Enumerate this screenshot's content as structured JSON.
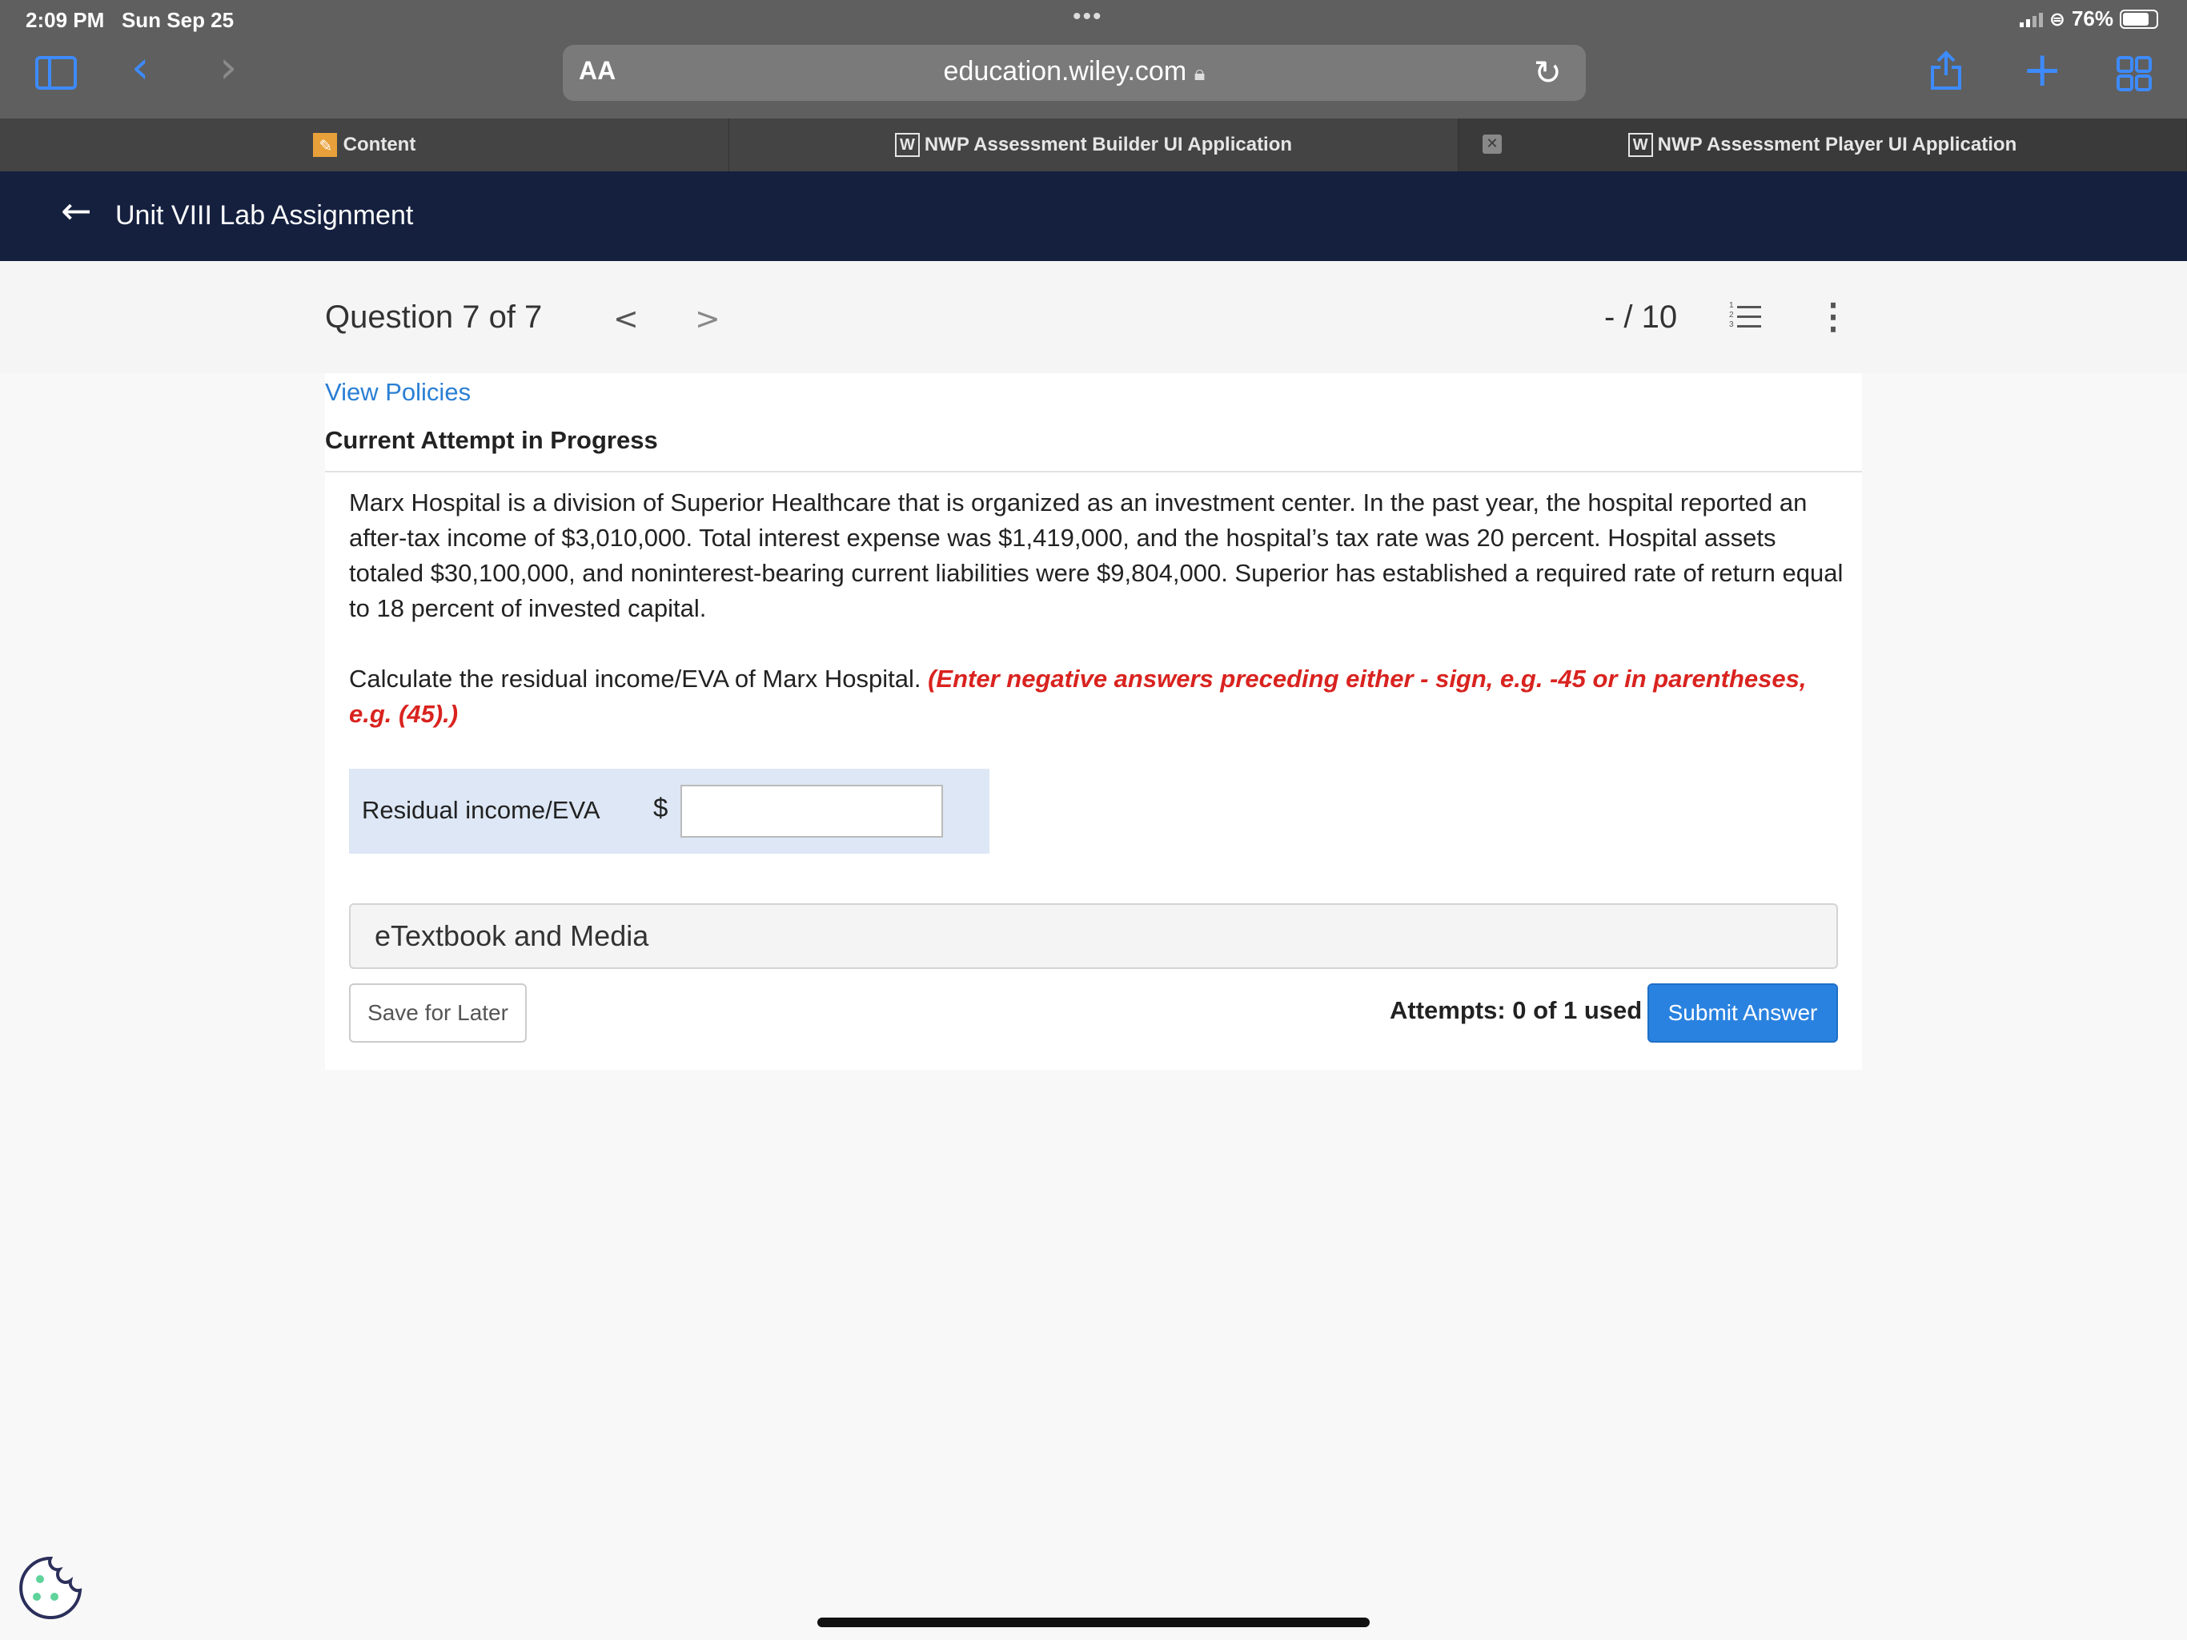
{
  "status_bar": {
    "time": "2:09 PM",
    "date": "Sun Sep 25",
    "dots": "•••",
    "battery_percent": "76%"
  },
  "browser": {
    "text_size_label": "AA",
    "url": "education.wiley.com",
    "lock_icon": "lock-icon",
    "reload_icon": "reload-icon",
    "accent_color": "#3d8bff"
  },
  "tabs": [
    {
      "label": "Content",
      "icon": "pencil-icon"
    },
    {
      "label": "NWP Assessment Builder UI Application",
      "icon": "w-logo-icon"
    },
    {
      "label": "NWP Assessment Player UI Application",
      "icon": "w-logo-icon"
    }
  ],
  "close_tab_glyph": "✕",
  "header": {
    "title": "Unit VIII Lab Assignment",
    "background_color": "#15203f"
  },
  "question_bar": {
    "title": "Question 7 of 7",
    "prev_glyph": "<",
    "next_glyph": ">",
    "score": "- / 10"
  },
  "card": {
    "view_policies": "View Policies",
    "attempt_heading": "Current Attempt in Progress",
    "problem_text": "Marx Hospital is a division of Superior Healthcare that is organized as an investment center. In the past year, the hospital reported an after-tax income of $3,010,000. Total interest expense was $1,419,000, and the hospital’s tax rate was 20 percent. Hospital assets totaled $30,100,000, and noninterest-bearing current liabilities were $9,804,000. Superior has established a required rate of return equal to 18 percent of invested capital.",
    "instruction": "Calculate the residual income/EVA of Marx Hospital.",
    "instruction_note": "(Enter negative answers preceding either - sign, e.g. -45 or in parentheses, e.g. (45).)",
    "answer_label": "Residual income/EVA",
    "currency": "$",
    "answer_value": "",
    "etextbook_label": "eTextbook and Media",
    "save_label": "Save for Later",
    "attempts_text": "Attempts: 0 of 1 used",
    "submit_label": "Submit Answer",
    "note_color": "#d9231f",
    "submit_color": "#2a82e0"
  }
}
